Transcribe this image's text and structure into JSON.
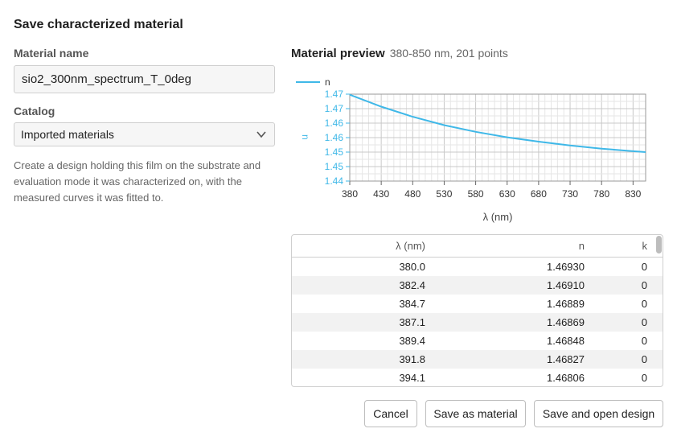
{
  "dialog": {
    "title": "Save characterized material"
  },
  "form": {
    "name_label": "Material name",
    "name_value": "sio2_300nm_spectrum_T_0deg",
    "catalog_label": "Catalog",
    "catalog_value": "Imported materials",
    "help_text": "Create a design holding this film on the substrate and evaluation mode it was characterized on, with the measured curves it was fitted to."
  },
  "preview": {
    "title": "Material preview",
    "subtitle": "380-850 nm, 201 points"
  },
  "chart_data": {
    "type": "line",
    "xlabel": "λ (nm)",
    "ylabel": "n",
    "xlim": [
      380,
      850
    ],
    "ylim": [
      1.4395,
      1.4695
    ],
    "x_ticks": [
      380,
      430,
      480,
      530,
      580,
      630,
      680,
      730,
      780,
      830
    ],
    "y_ticks": [
      1.44,
      1.45,
      1.45,
      1.46,
      1.46,
      1.47,
      1.47
    ],
    "grid": true,
    "legend": "top-left",
    "series": [
      {
        "name": "n",
        "color": "#3fb8e8",
        "x": [
          380,
          430,
          480,
          530,
          580,
          630,
          680,
          730,
          780,
          830,
          850
        ],
        "y": [
          1.4693,
          1.4652,
          1.4617,
          1.4588,
          1.4565,
          1.4546,
          1.4531,
          1.4518,
          1.4507,
          1.4498,
          1.4495
        ]
      }
    ]
  },
  "table": {
    "headers": [
      "λ (nm)",
      "n",
      "k"
    ],
    "rows": [
      [
        "380.0",
        "1.46930",
        "0"
      ],
      [
        "382.4",
        "1.46910",
        "0"
      ],
      [
        "384.7",
        "1.46889",
        "0"
      ],
      [
        "387.1",
        "1.46869",
        "0"
      ],
      [
        "389.4",
        "1.46848",
        "0"
      ],
      [
        "391.8",
        "1.46827",
        "0"
      ],
      [
        "394.1",
        "1.46806",
        "0"
      ]
    ]
  },
  "buttons": {
    "cancel": "Cancel",
    "save": "Save as material",
    "open": "Save and open design"
  },
  "colors": {
    "series": "#3fb8e8",
    "accent": "#3fb8e8"
  }
}
